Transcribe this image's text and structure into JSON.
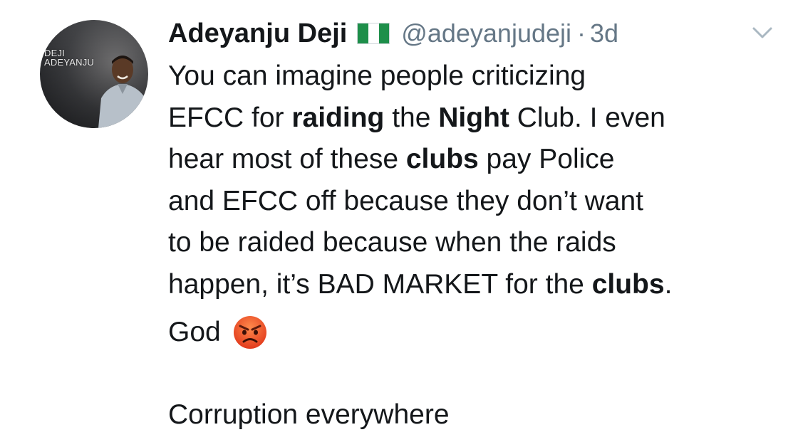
{
  "tweet": {
    "author_name": "Adeyanju Deji",
    "handle": "@adeyanjudeji",
    "separator": "·",
    "time": "3d",
    "avatar_text": [
      "DEJI",
      "ADEYANJU"
    ],
    "flag_icon": "nigeria-flag-icon",
    "menu_icon": "chevron-down-icon",
    "body_lines": [
      [
        {
          "t": "You can imagine people criticizing",
          "b": false
        }
      ],
      [
        {
          "t": "EFCC for ",
          "b": false
        },
        {
          "t": "raiding",
          "b": true
        },
        {
          "t": " the ",
          "b": false
        },
        {
          "t": "Night",
          "b": true
        },
        {
          "t": " Club. I even",
          "b": false
        }
      ],
      [
        {
          "t": "hear most of these ",
          "b": false
        },
        {
          "t": "clubs",
          "b": true
        },
        {
          "t": " pay Police",
          "b": false
        }
      ],
      [
        {
          "t": "and EFCC off because they don’t want",
          "b": false
        }
      ],
      [
        {
          "t": "to be raided because when the raids",
          "b": false
        }
      ],
      [
        {
          "t": "happen, it’s BAD MARKET for the ",
          "b": false
        },
        {
          "t": "clubs",
          "b": true
        },
        {
          "t": ".",
          "b": false
        }
      ]
    ],
    "god_text": "God",
    "emoji_icon": "angry-face-emoji",
    "corruption_text": "Corruption everywhere",
    "colors": {
      "text": "#14171a",
      "secondary": "#657786",
      "flag_green": "#1e8f4a",
      "emoji_red": "#e8542a"
    }
  }
}
